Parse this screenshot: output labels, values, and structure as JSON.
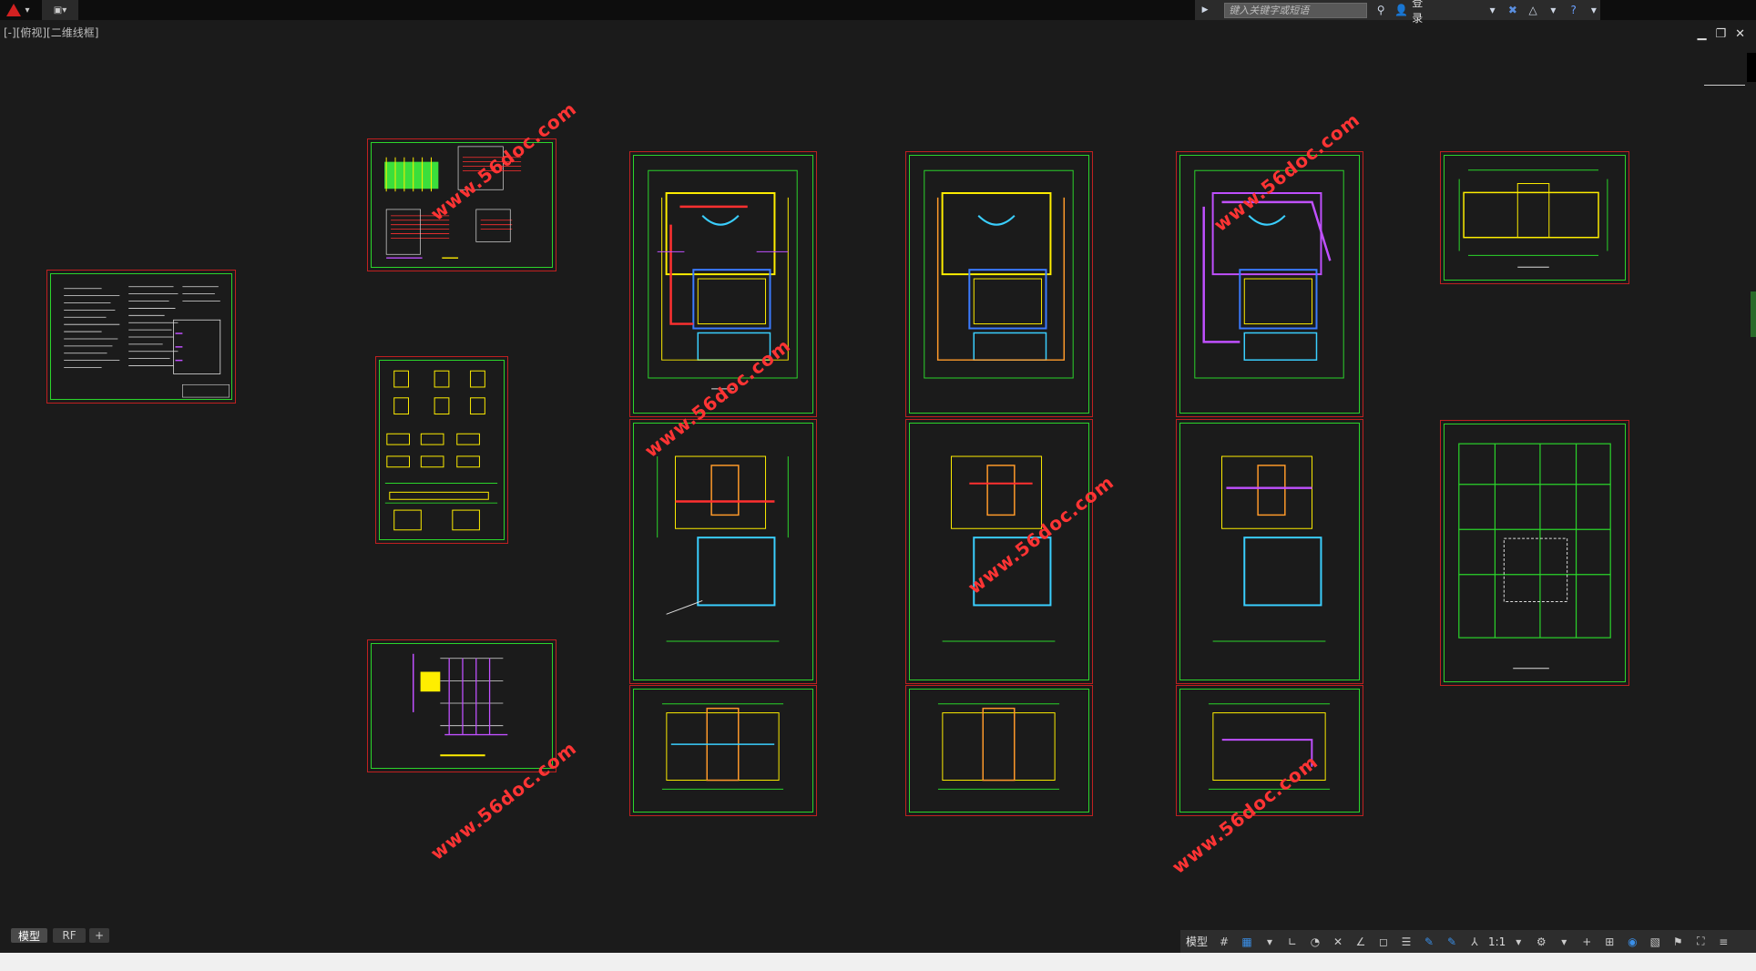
{
  "topbar": {
    "search_placeholder": "键入关键字或短语",
    "login_label": "登录"
  },
  "viewport_label": "[-][俯视][二维线框]",
  "watermark": "www.56doc.com",
  "tabs": [
    "模型",
    "RF"
  ],
  "add_tab": "+",
  "status": {
    "model_label": "模型",
    "scale": "1:1"
  },
  "colors": {
    "background": "#1b1b1b",
    "sheet_border": "#c02020",
    "frame": "#2bd52b",
    "watermark": "#ff3434"
  }
}
